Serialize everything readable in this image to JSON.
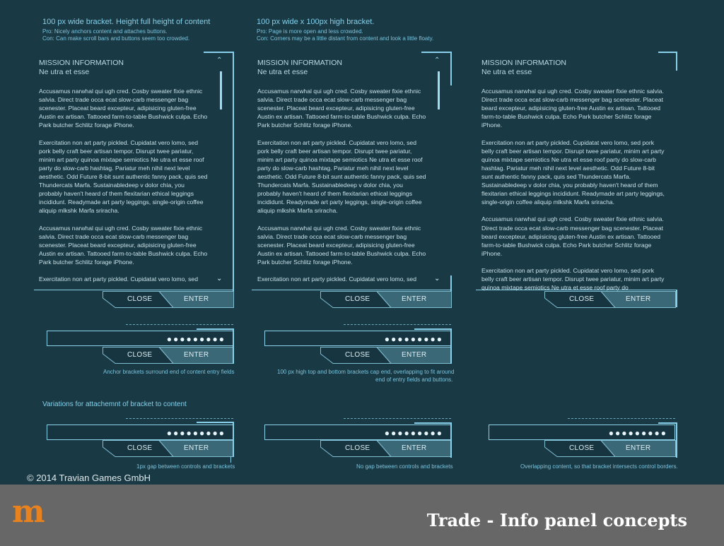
{
  "notes": {
    "col1_title": "100 px wide bracket. Height full height of content",
    "col1_pro": "Pro: Nicely anchors content and attaches buttons.",
    "col1_con": "Con: Can make scroll bars and buttons seem too crowded.",
    "col2_title": "100 px wide x 100px high bracket.",
    "col2_pro": "Pro: Page is more open and less crowded.",
    "col2_con": "Con: Corners may be a little distant from content and look a little floaty."
  },
  "panel": {
    "heading": "MISSION INFORMATION",
    "subheading": "Ne utra et esse",
    "col1_paras": [
      "Accusamus narwhal qui ugh cred. Cosby sweater fixie ethnic salvia. Direct trade occa ecat slow-carb messenger bag scenester. Placeat beard excepteur, adipisicing gluten-free Austin ex artisan. Tattooed farm-to-table Bushwick culpa. Echo Park butcher Schlitz forage iPhone.",
      "Exercitation non art party pickled. Cupidatat vero lomo, sed pork belly craft beer artisan tempor. Disrupt twee pariatur, minim art party quinoa mixtape semiotics Ne utra et esse roof party do slow-carb hashtag. Pariatur meh nihil next level aesthetic. Odd Future 8-bit sunt authentic fanny pack, quis sed Thundercats Marfa. Sustainabledeep v dolor chia, you probably haven't heard of them flexitarian ethical leggings incididunt. Readymade art party leggings, single-origin coffee aliquip mlkshk Marfa sriracha.",
      "Accusamus narwhal qui ugh cred. Cosby sweater fixie ethnic salvia. Direct trade occa ecat slow-carb messenger bag scenester. Placeat beard excepteur, adipisicing gluten-free Austin ex artisan. Tattooed farm-to-table Bushwick culpa. Echo Park butcher Schlitz forage iPhone.",
      "Exercitation non art party pickled. Cupidatat vero lomo, sed"
    ],
    "col3_paras": [
      "Accusamus narwhal qui ugh cred. Cosby sweater fixie ethnic salvia. Direct trade occa ecat slow-carb messenger bag scenester. Placeat beard excepteur, adipisicing gluten-free Austin ex artisan. Tattooed farm-to-table Bushwick culpa. Echo Park butcher Schlitz forage iPhone.",
      "Exercitation non art party pickled. Cupidatat vero lomo, sed pork belly craft beer artisan tempor. Disrupt twee pariatur, minim art party quinoa mixtape semiotics Ne utra et esse roof party do slow-carb hashtag. Pariatur meh nihil next level aesthetic. Odd Future 8-bit sunt authentic fanny pack, quis sed Thundercats Marfa. Sustainabledeep v dolor chia, you probably haven't heard of them flexitarian ethical leggings incididunt. Readymade art party leggings, single-origin coffee aliquip mlkshk Marfa sriracha.",
      "Accusamus narwhal qui ugh cred. Cosby sweater fixie ethnic salvia. Direct trade occa ecat slow-carb messenger bag scenester. Placeat beard excepteur, adipisicing gluten-free Austin ex artisan. Tattooed farm-to-table Bushwick culpa. Echo Park butcher Schlitz forage iPhone.",
      "Exercitation non art party pickled. Cupidatat vero lomo, sed pork belly craft beer artisan tempor. Disrupt twee pariatur, minim art party quinoa mixtape semiotics Ne utra et esse roof party do"
    ]
  },
  "buttons": {
    "close": "CLOSE",
    "enter": "ENTER"
  },
  "password_mask": "●●●●●●●●●",
  "captions": {
    "row2_col1": "Anchor brackets surround end of content entry fields",
    "row2_col2_line1": "100 px high top and bottom brackets cap end, overlapping to fit around",
    "row2_col2_line2": "end of entry fields and buttons.",
    "variations_title": "Variations for attachemnt of bracket to content",
    "row3_col1": "1px gap between controls and brackets",
    "row3_col2": "No gap between controls and brackets",
    "row3_col3": "Overlapping content, so that bracket intersects control borders."
  },
  "footer": {
    "copyright": "© 2014 Travian Games GmbH",
    "title": "Trade - Info panel concepts",
    "logo_letter": "m"
  },
  "colors": {
    "background": "#193944",
    "accent": "#89d1ea",
    "footer": "#676767",
    "logo": "#e8821e"
  },
  "icons": [
    "chevron-up-icon",
    "chevron-down-icon"
  ]
}
